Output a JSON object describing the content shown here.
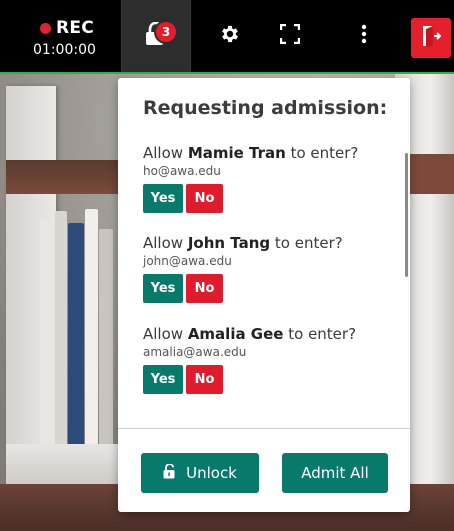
{
  "toolbar": {
    "rec_label": "REC",
    "rec_time": "01:00:00",
    "lock_badge_count": "3",
    "icons": [
      "lock-open-icon",
      "gear-icon",
      "fullscreen-icon",
      "more-vertical-icon",
      "leave-door-icon"
    ],
    "accent_color": "#2bb24c",
    "leave_color": "#e51f2d"
  },
  "panel": {
    "title": "Requesting admission:",
    "requests": [
      {
        "prefix": "Allow ",
        "name": "Mamie Tran",
        "suffix": " to enter?",
        "email": "ho@awa.edu",
        "yes": "Yes",
        "no": "No"
      },
      {
        "prefix": "Allow ",
        "name": "John Tang",
        "suffix": " to enter?",
        "email": "john@awa.edu",
        "yes": "Yes",
        "no": "No"
      },
      {
        "prefix": "Allow ",
        "name": "Amalia Gee",
        "suffix": " to enter?",
        "email": "amalia@awa.edu",
        "yes": "Yes",
        "no": "No"
      }
    ],
    "unlock_label": "Unlock",
    "admit_all_label": "Admit All",
    "yes_color": "#077a6b",
    "no_color": "#e01c2c"
  }
}
